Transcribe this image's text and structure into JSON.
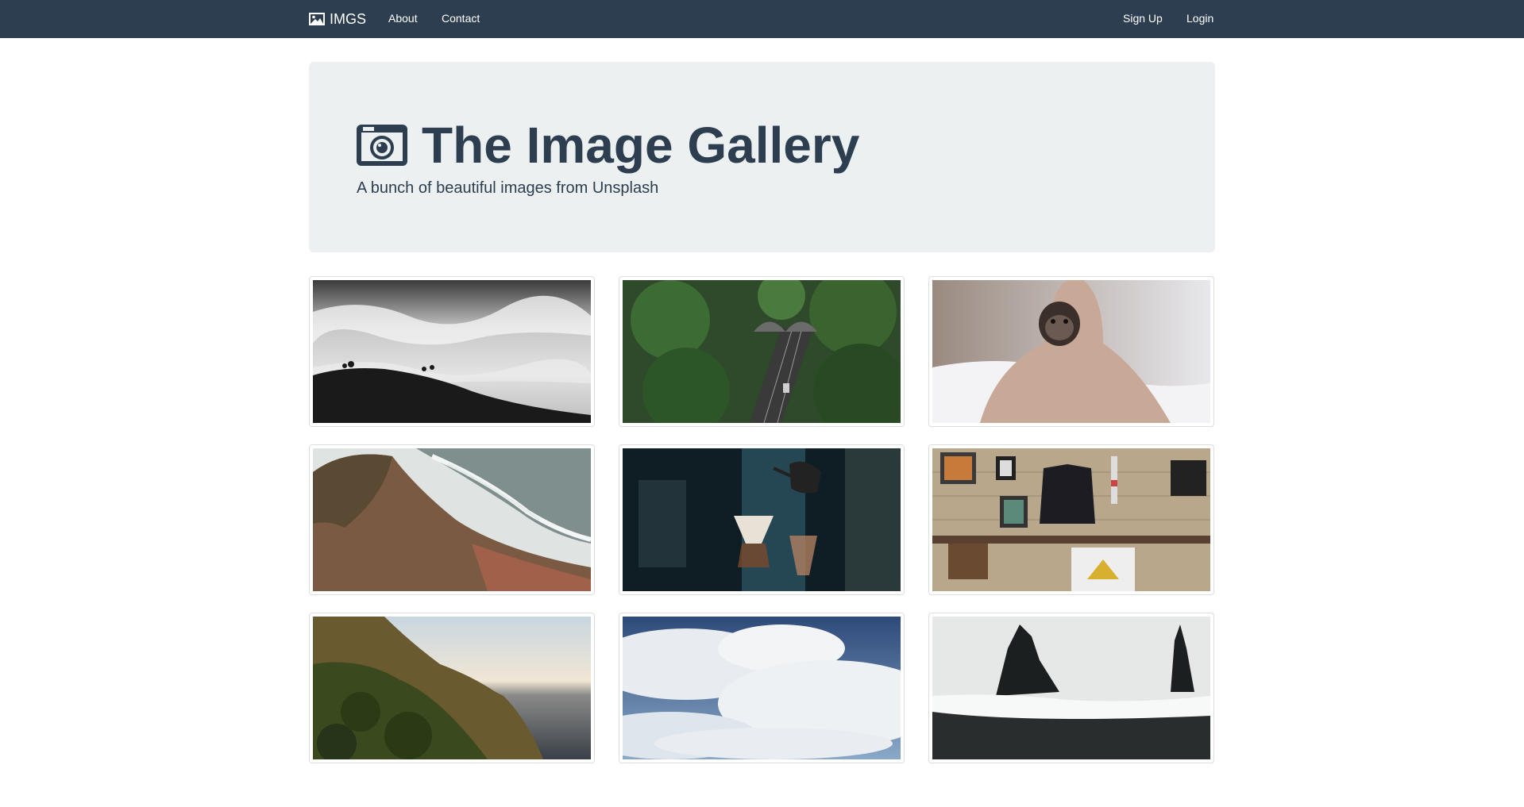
{
  "nav": {
    "brand": "IMGS",
    "links": [
      "About",
      "Contact"
    ],
    "right_links": [
      "Sign Up",
      "Login"
    ]
  },
  "jumbotron": {
    "title": "The Image Gallery",
    "subtitle": "A bunch of beautiful images from Unsplash"
  },
  "gallery": {
    "images": [
      {
        "subject": "foggy hills black and white"
      },
      {
        "subject": "aerial road tunnel through forest"
      },
      {
        "subject": "pug in blanket"
      },
      {
        "subject": "coastal cliff and beach"
      },
      {
        "subject": "pour-over coffee"
      },
      {
        "subject": "wall with jacket and frames"
      },
      {
        "subject": "mountain coastline at sunset"
      },
      {
        "subject": "sky with clouds"
      },
      {
        "subject": "black sand beach with sea stacks"
      }
    ]
  },
  "colors": {
    "navbar": "#2c3e50",
    "jumbotron_bg": "#ecf0f1",
    "text_dark": "#2c3e50"
  }
}
